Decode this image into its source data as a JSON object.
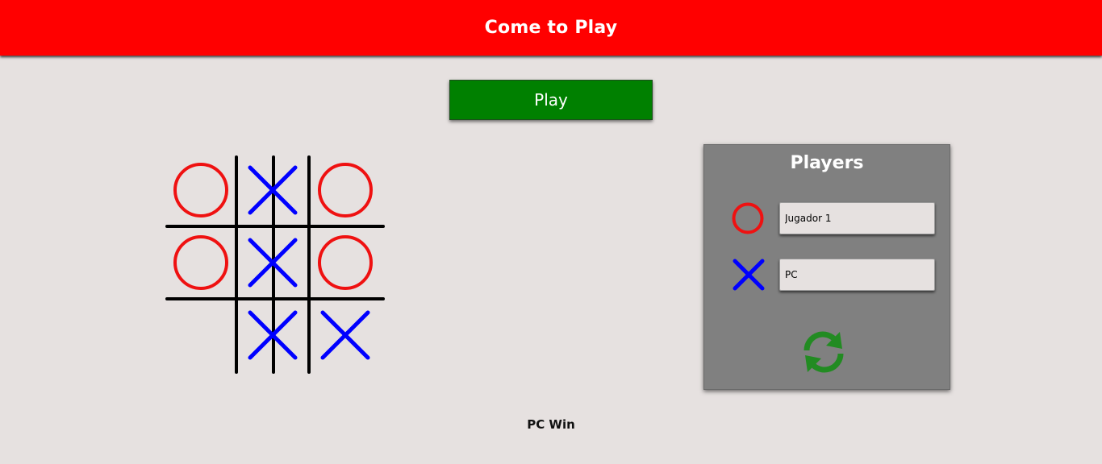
{
  "header": {
    "title": "Come to Play",
    "bg_color": "#ff0000"
  },
  "play_button": {
    "label": "Play",
    "color": "#008000"
  },
  "board": {
    "cells": [
      [
        "O",
        "X",
        "O"
      ],
      [
        "O",
        "X",
        "O"
      ],
      [
        "",
        "X",
        "X"
      ]
    ],
    "o_color": "#ef1111",
    "x_color": "#0000ff",
    "grid_color": "#000000"
  },
  "players_panel": {
    "title": "Players",
    "players": [
      {
        "mark": "O",
        "name": "Jugador 1"
      },
      {
        "mark": "X",
        "name": "PC"
      }
    ],
    "restart_icon": "refresh-icon",
    "restart_color": "#228b22"
  },
  "status": {
    "result": "PC Win"
  }
}
